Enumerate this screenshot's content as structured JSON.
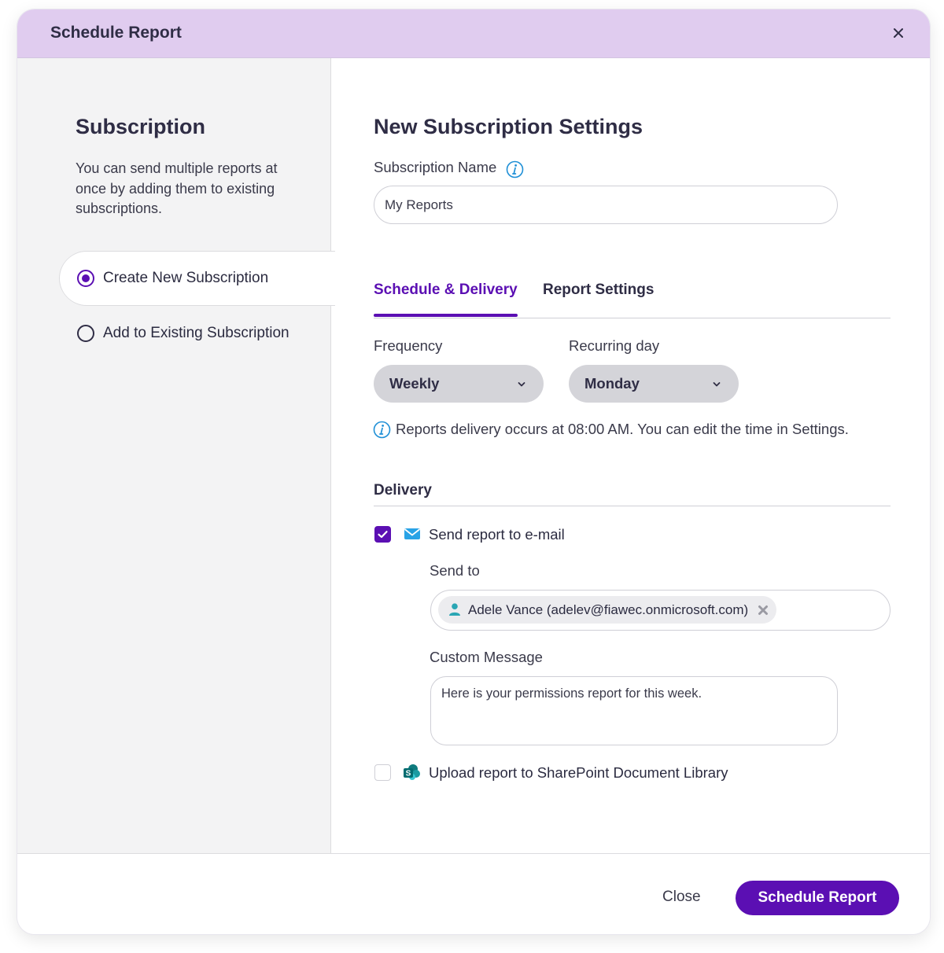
{
  "dialog": {
    "title": "Schedule Report",
    "close_icon": "close-icon"
  },
  "left": {
    "title": "Subscription",
    "description": "You can send multiple reports at once by adding them to existing subscriptions.",
    "options": [
      {
        "label": "Create New Subscription",
        "selected": true
      },
      {
        "label": "Add to Existing Subscription",
        "selected": false
      }
    ]
  },
  "main": {
    "title": "New Subscription Settings",
    "subscription_name_label": "Subscription Name",
    "subscription_name_value": "My Reports",
    "tabs": [
      {
        "label": "Schedule & Delivery",
        "active": true
      },
      {
        "label": "Report Settings",
        "active": false
      }
    ],
    "frequency_label": "Frequency",
    "frequency_value": "Weekly",
    "recurring_label": "Recurring day",
    "recurring_value": "Monday",
    "delivery_note": "Reports delivery occurs at 08:00 AM. You can edit the time in Settings.",
    "delivery_title": "Delivery",
    "email_option": {
      "label": "Send report to e-mail",
      "checked": true,
      "icon": "mail-icon"
    },
    "send_to_label": "Send to",
    "recipient_chip": "Adele Vance (adelev@fiawec.onmicrosoft.com)",
    "custom_message_label": "Custom Message",
    "custom_message_value": "Here is your permissions report for this week.",
    "sharepoint_option": {
      "label": "Upload report to SharePoint Document Library",
      "checked": false,
      "icon": "sharepoint-icon"
    }
  },
  "footer": {
    "close_label": "Close",
    "primary_label": "Schedule Report"
  },
  "colors": {
    "accent": "#5b0fb3",
    "header_bg": "#e0ccef",
    "info_blue": "#1e8fd6",
    "mail_blue": "#29a3e6",
    "sharepoint_teal": "#0f7b7e"
  }
}
